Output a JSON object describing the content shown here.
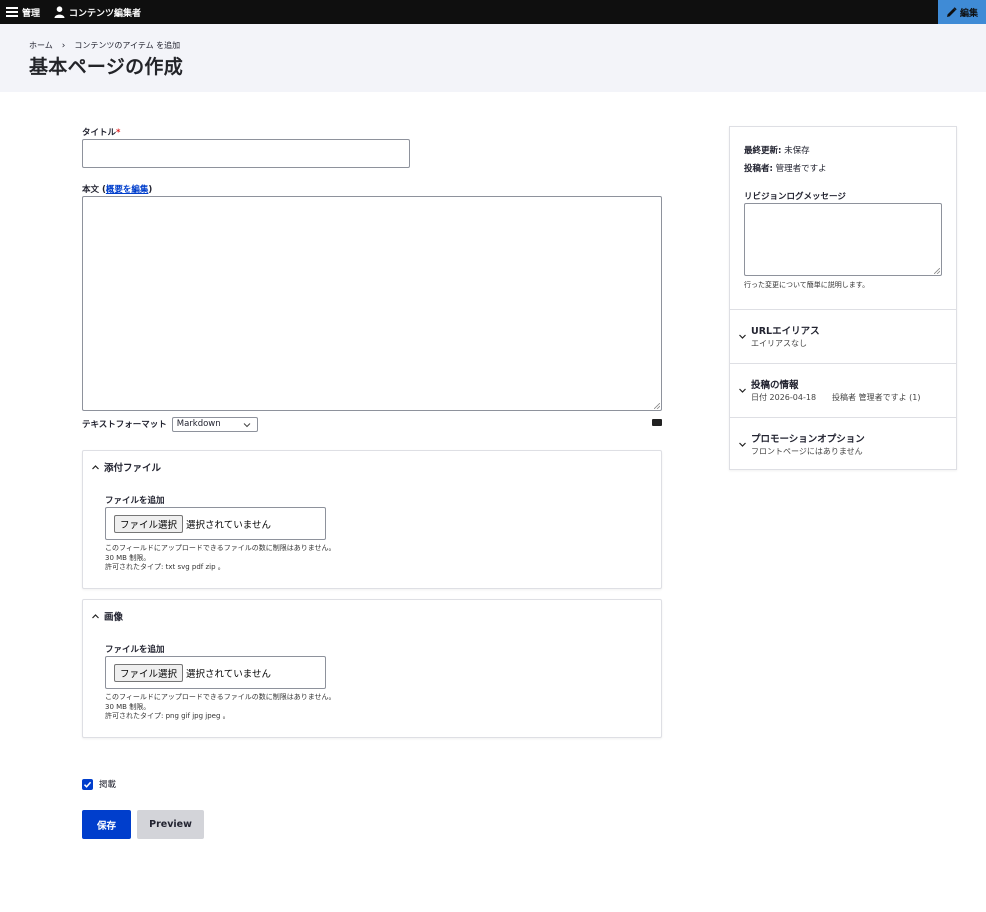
{
  "toolbar": {
    "manage_label": "管理",
    "user_label": "コンテンツ編集者",
    "edit_label": "編集"
  },
  "breadcrumb": {
    "home": "ホーム",
    "separator": "›",
    "add_content": "コンテンツのアイテム を追加"
  },
  "page_title": "基本ページの作成",
  "form": {
    "title_label": "タイトル",
    "required_marker": "*",
    "title_value": "",
    "body_label_prefix": "本文 (",
    "body_summary_link": "概要を編集",
    "body_label_suffix": ")",
    "body_value": "",
    "text_format_label": "テキストフォーマット",
    "text_format_selected": "Markdown",
    "attachments": {
      "summary": "添付ファイル",
      "add_label": "ファイルを追加",
      "choose_button": "ファイル選択",
      "no_file": "選択されていません",
      "help_line1": "このフィールドにアップロードできるファイルの数に制限はありません。",
      "help_line2": "30 MB 制限。",
      "help_line3": "許可されたタイプ: txt svg pdf zip 。"
    },
    "images": {
      "summary": "画像",
      "add_label": "ファイルを追加",
      "choose_button": "ファイル選択",
      "no_file": "選択されていません",
      "help_line1": "このフィールドにアップロードできるファイルの数に制限はありません。",
      "help_line2": "30 MB 制限。",
      "help_line3": "許可されたタイプ: png gif jpg jpeg 。"
    },
    "published_label": "掲載",
    "published_checked": true,
    "save_button": "保存",
    "preview_button": "Preview"
  },
  "sidebar": {
    "last_updated_label": "最終更新:",
    "last_updated_value": "未保存",
    "author_label": "投稿者:",
    "author_value": "管理者ですよ",
    "revision_label": "リビジョンログメッセージ",
    "revision_value": "",
    "revision_help": "行った変更について簡単に説明します。",
    "sections": [
      {
        "title": "URLエイリアス",
        "summary": "エイリアスなし"
      },
      {
        "title": "投稿の情報",
        "summary": "日付 2026-04-18　　投稿者 管理者ですよ (1)"
      },
      {
        "title": "プロモーションオプション",
        "summary": "フロントページにはありません"
      }
    ]
  },
  "colors": {
    "toolbar_bg": "#0f0f0f",
    "edit_tab_bg": "#3f8bd6",
    "header_bg": "#f3f4f9",
    "primary": "#003ecc",
    "required": "#dc2323",
    "secondary_button": "#d3d4d9"
  }
}
